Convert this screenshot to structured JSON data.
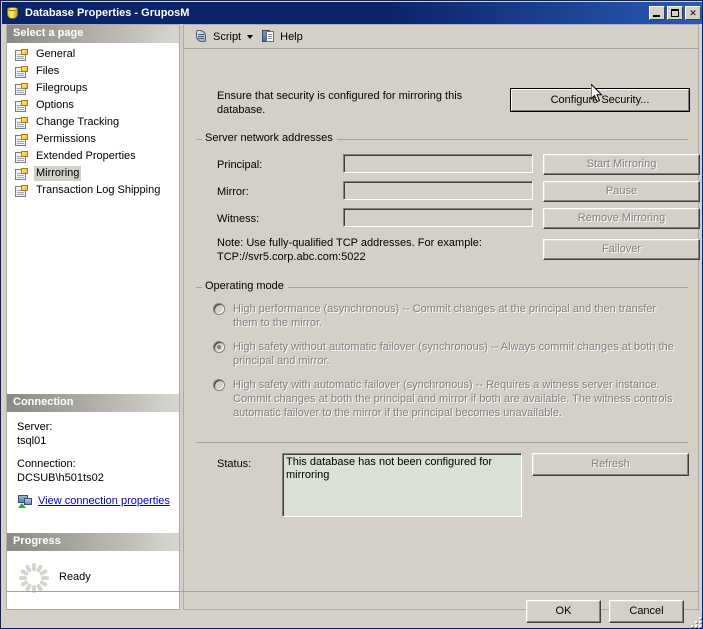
{
  "window": {
    "title": "Database Properties - GruposM",
    "icon": "database-cylinder-icon",
    "minimize_label": "Minimize",
    "maximize_label": "Maximize",
    "close_label": "Close"
  },
  "sidebar": {
    "header": "Select a page",
    "items": [
      {
        "label": "General",
        "selected": false
      },
      {
        "label": "Files",
        "selected": false
      },
      {
        "label": "Filegroups",
        "selected": false
      },
      {
        "label": "Options",
        "selected": false
      },
      {
        "label": "Change Tracking",
        "selected": false
      },
      {
        "label": "Permissions",
        "selected": false
      },
      {
        "label": "Extended Properties",
        "selected": false
      },
      {
        "label": "Mirroring",
        "selected": true
      },
      {
        "label": "Transaction Log Shipping",
        "selected": false
      }
    ]
  },
  "connection": {
    "header": "Connection",
    "server_label": "Server:",
    "server_value": "tsql01",
    "connection_label": "Connection:",
    "connection_value": "DCSUB\\h501ts02",
    "link_label": "View connection properties"
  },
  "progress": {
    "header": "Progress",
    "status": "Ready"
  },
  "toolbar": {
    "script_label": "Script",
    "help_label": "Help"
  },
  "main": {
    "intro_text": "Ensure that security is configured for mirroring this database.",
    "configure_security_label": "Configure Security...",
    "network": {
      "group_title": "Server network addresses",
      "fields": [
        {
          "label": "Principal:",
          "value": ""
        },
        {
          "label": "Mirror:",
          "value": ""
        },
        {
          "label": "Witness:",
          "value": ""
        }
      ],
      "note": "Note: Use fully-qualified TCP addresses. For example:\nTCP://svr5.corp.abc.com:5022",
      "buttons": [
        {
          "label": "Start Mirroring",
          "disabled": true
        },
        {
          "label": "Pause",
          "disabled": true
        },
        {
          "label": "Remove Mirroring",
          "disabled": true
        },
        {
          "label": "Failover",
          "disabled": true
        }
      ]
    },
    "operating_mode": {
      "group_title": "Operating mode",
      "options": [
        {
          "label": "High performance (asynchronous) -- Commit changes at the principal and then transfer them to the mirror.",
          "selected": false,
          "disabled": true
        },
        {
          "label": "High safety without automatic failover (synchronous) -- Always commit changes at both the principal and mirror.",
          "selected": true,
          "disabled": true
        },
        {
          "label": "High safety with automatic failover (synchronous) -- Requires a witness server instance. Commit changes at both the principal and mirror if both are available. The witness controls automatic failover to the mirror if the principal becomes unavailable.",
          "selected": false,
          "disabled": true
        }
      ]
    },
    "status": {
      "label": "Status:",
      "text": "This database has not been configured for mirroring",
      "refresh_label": "Refresh",
      "refresh_disabled": true
    }
  },
  "footer": {
    "ok_label": "OK",
    "cancel_label": "Cancel"
  },
  "colors": {
    "titlebar_start": "#0a246a",
    "titlebar_end": "#2a5ab4",
    "window_face": "#d4d0c8",
    "link": "#0000cc",
    "disabled_text": "#808080",
    "status_box_bg": "#d9e0d4"
  }
}
